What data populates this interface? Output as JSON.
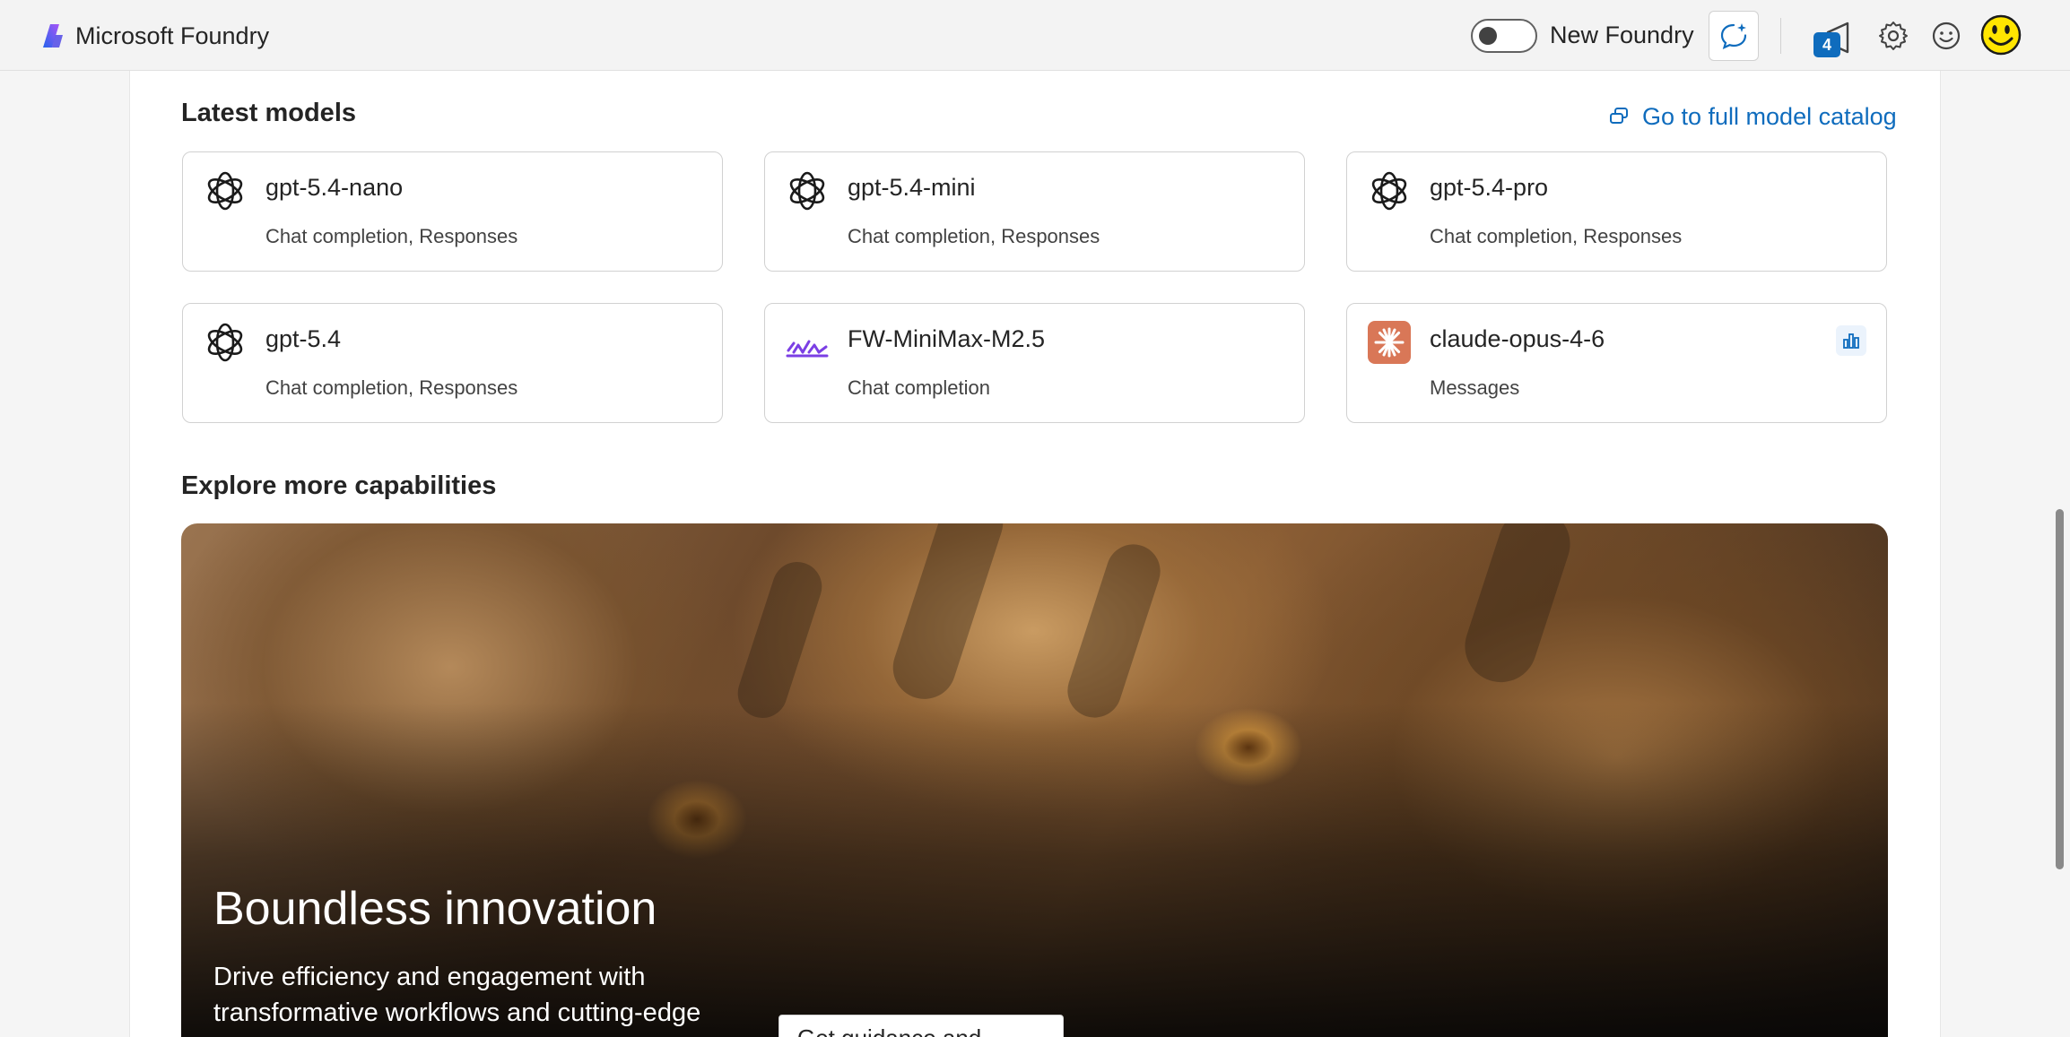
{
  "app": {
    "title": "Microsoft Foundry"
  },
  "header": {
    "toggle_label": "New Foundry",
    "toggle_on": false,
    "notification_count": "4",
    "icons": [
      "copilot-chat-icon",
      "announcement-icon",
      "settings-icon",
      "feedback-smiley-icon",
      "user-avatar"
    ]
  },
  "latest_models": {
    "title": "Latest models",
    "catalog_link": "Go to full model catalog",
    "cards": [
      {
        "name": "gpt-5.4-nano",
        "capabilities": "Chat completion, Responses",
        "icon": "openai-logo-icon"
      },
      {
        "name": "gpt-5.4-mini",
        "capabilities": "Chat completion, Responses",
        "icon": "openai-logo-icon"
      },
      {
        "name": "gpt-5.4-pro",
        "capabilities": "Chat completion, Responses",
        "icon": "openai-logo-icon"
      },
      {
        "name": "gpt-5.4",
        "capabilities": "Chat completion, Responses",
        "icon": "openai-logo-icon"
      },
      {
        "name": "FW-MiniMax-M2.5",
        "capabilities": "Chat completion",
        "icon": "minimax-logo-icon"
      },
      {
        "name": "claude-opus-4-6",
        "capabilities": "Messages",
        "icon": "anthropic-logo-icon"
      }
    ]
  },
  "explore": {
    "title": "Explore more capabilities",
    "hero_title": "Boundless innovation",
    "hero_description": "Drive efficiency and engagement with transformative workflows and cutting-edge",
    "hero_button": "Get guidance and"
  },
  "colors": {
    "accent": "#0f6cbd",
    "anthropic": "#d97757",
    "minimax": "#7b3fe4"
  }
}
